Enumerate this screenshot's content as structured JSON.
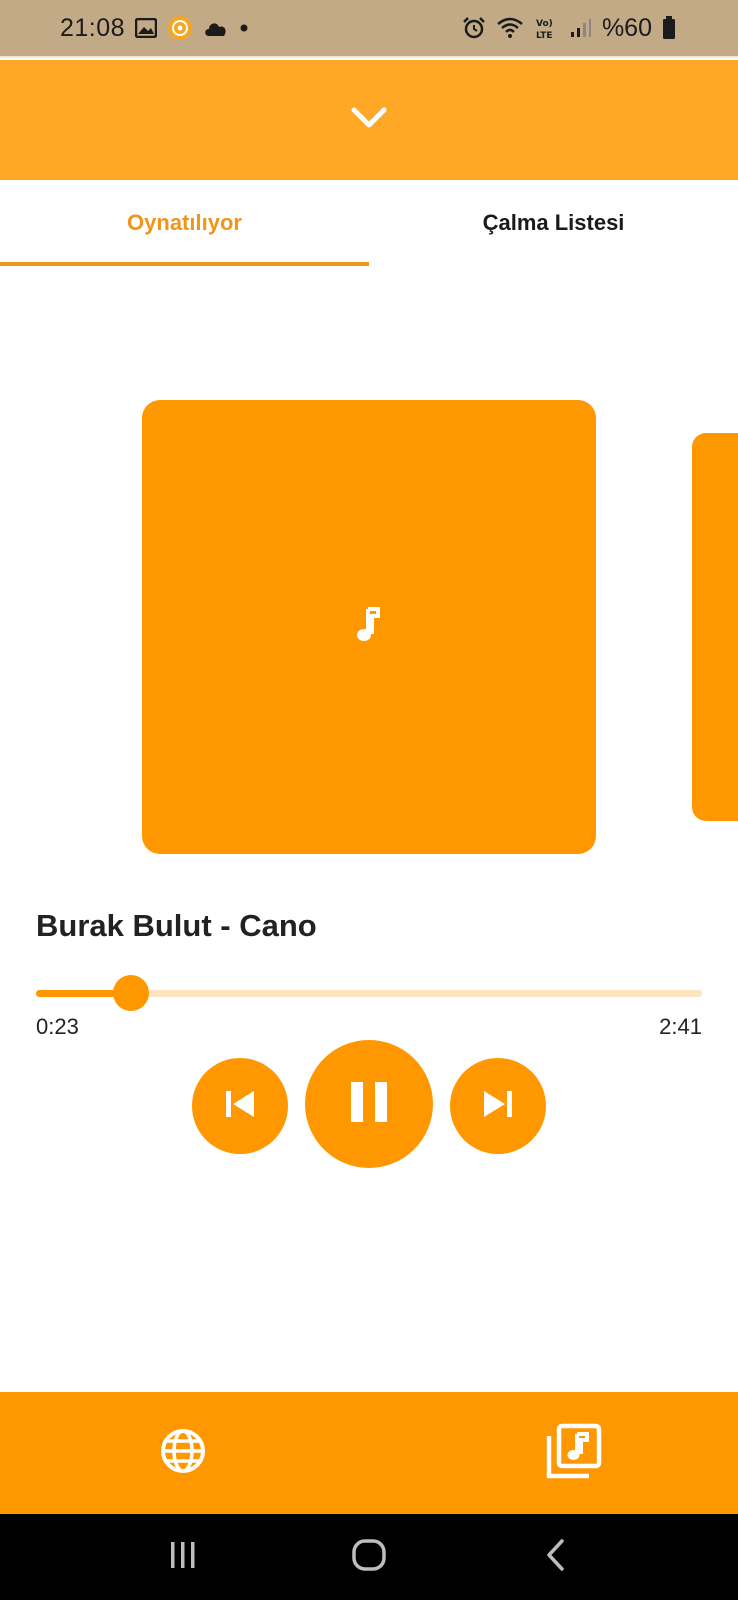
{
  "status_bar": {
    "time": "21:08",
    "battery_text": "%60",
    "icons_left": [
      "gallery-icon",
      "app-notification-icon",
      "cloud-icon",
      "dot-icon"
    ],
    "icons_right": [
      "alarm-icon",
      "wifi-icon",
      "volte-icon",
      "signal-icon",
      "battery-icon"
    ]
  },
  "top_bar": {
    "icon": "chevron-down-icon",
    "color": "#ffa726"
  },
  "tabs": [
    {
      "label": "Oynatılıyor",
      "active": true
    },
    {
      "label": "Çalma Listesi",
      "active": false
    }
  ],
  "player": {
    "artwork_icon": "music-note-icon",
    "song_title": "Burak Bulut - Cano",
    "current_time": "0:23",
    "total_time": "2:41",
    "progress": 0.143
  },
  "controls": {
    "prev_icon": "skip-previous-icon",
    "play_icon": "pause-icon",
    "next_icon": "skip-next-icon"
  },
  "bottom_bar": {
    "left_icon": "globe-icon",
    "right_icon": "music-library-icon"
  },
  "nav_bar": {
    "icons": [
      "recent-apps-icon",
      "home-icon",
      "back-icon"
    ]
  },
  "colors": {
    "accent": "#ff9800",
    "accent_light": "#ffa726",
    "track": "#ffe4c0",
    "active_tab": "#f0961a",
    "status_bar": "#c2aa86"
  }
}
